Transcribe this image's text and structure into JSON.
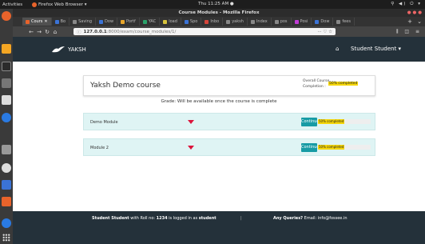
{
  "system": {
    "activities": "Activities",
    "app_name": "Firefox Web Browser ▾",
    "clock": "Thu 11:25 AM ●",
    "tray": "⚲ ◀) ⏻ ▾"
  },
  "browser": {
    "window_title": "Course Modules - Mozilla Firefox",
    "tabs": [
      {
        "label": "Cours",
        "color": "#e8632b",
        "active": true
      },
      {
        "label": "Bo",
        "color": "#3b73d6"
      },
      {
        "label": "Saving",
        "color": "#888888"
      },
      {
        "label": "Dow",
        "color": "#3b73d6"
      },
      {
        "label": "Portf",
        "color": "#e8a62b"
      },
      {
        "label": "YAC",
        "color": "#2ba36b"
      },
      {
        "label": "load",
        "color": "#d6c23b"
      },
      {
        "label": "Spo",
        "color": "#3b73d6"
      },
      {
        "label": "Inbo",
        "color": "#d6453b"
      },
      {
        "label": "yaksh",
        "color": "#888888"
      },
      {
        "label": "Index",
        "color": "#888888"
      },
      {
        "label": "pos",
        "color": "#888888"
      },
      {
        "label": "Posi",
        "color": "#c03bd6"
      },
      {
        "label": "Dow",
        "color": "#3b73d6"
      },
      {
        "label": "fees",
        "color": "#888888"
      }
    ],
    "url_host": "127.0.0.1",
    "url_path": ":8000/exam/course_modules/1/",
    "url_icons": "··· ♡ ☆",
    "right_icons": "⫼ ◫ ≡"
  },
  "site": {
    "brand": "YAKSH",
    "user_menu": "Student Student ▾",
    "course_title": "Yaksh Demo course",
    "overall_label_1": "Overall Course",
    "overall_label_2": "Completion :",
    "overall_pct": "50% completed",
    "overall_progress": 0.5,
    "grade_text": "Grade: Will be available once the course is complete",
    "modules": [
      {
        "name": "Demo Module",
        "button": "Continue",
        "progress_text": "50% completed",
        "progress": 0.5
      },
      {
        "name": "Module 2",
        "button": "Continue",
        "progress_text": "50% completed",
        "progress": 0.5
      }
    ],
    "footer": {
      "left_pre": "Student Student",
      "left_mid": " with Roll no: ",
      "roll": "1234",
      "left_post": " is logged in as ",
      "role": "student",
      "sep": "|",
      "queries_label": "Any Queries?",
      "queries_text": " Email: info@fossee.in"
    }
  },
  "colors": {
    "accent": "#179ba5",
    "navbar": "#24313a",
    "progress": "#f5d60a",
    "module_bg": "#dff4f4"
  }
}
